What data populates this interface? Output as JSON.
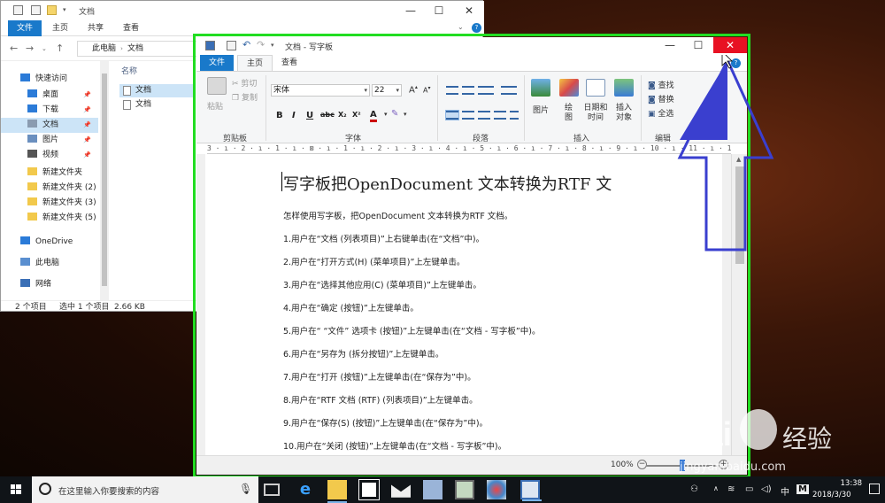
{
  "explorer": {
    "title": "文档",
    "window_controls": {
      "minimize": "—",
      "maximize": "☐",
      "close": "✕"
    },
    "tabs": [
      "文件",
      "主页",
      "共享",
      "查看"
    ],
    "breadcrumb": [
      "此电脑",
      "文档"
    ],
    "sidebar": {
      "items": [
        {
          "label": "快速访问",
          "icon": "star-icon"
        },
        {
          "label": "桌面",
          "icon": "desktop-icon",
          "pinned": true
        },
        {
          "label": "下载",
          "icon": "download-icon",
          "pinned": true
        },
        {
          "label": "文档",
          "icon": "document-icon",
          "pinned": true,
          "active": true
        },
        {
          "label": "图片",
          "icon": "picture-icon",
          "pinned": true
        },
        {
          "label": "视频",
          "icon": "video-icon",
          "pinned": true
        },
        {
          "label": "新建文件夹",
          "icon": "folder-icon"
        },
        {
          "label": "新建文件夹 (2)",
          "icon": "folder-icon"
        },
        {
          "label": "新建文件夹 (3)",
          "icon": "folder-icon"
        },
        {
          "label": "新建文件夹 (5)",
          "icon": "folder-icon"
        },
        {
          "label": "OneDrive",
          "icon": "cloud-icon"
        },
        {
          "label": "此电脑",
          "icon": "computer-icon"
        },
        {
          "label": "网络",
          "icon": "network-icon"
        }
      ]
    },
    "column_header": "名称",
    "files": [
      {
        "name": "文档",
        "selected": true
      },
      {
        "name": "文档",
        "selected": false
      }
    ],
    "status": {
      "count": "2 个项目",
      "selected": "选中 1 个项目",
      "size": "2.66 KB"
    }
  },
  "wordpad": {
    "title": "文档 - 写字板",
    "window_controls": {
      "minimize": "—",
      "maximize": "☐",
      "close": "✕"
    },
    "tabs": [
      "文件",
      "主页",
      "查看"
    ],
    "ribbon": {
      "clipboard": {
        "label": "剪贴板",
        "paste": "粘贴",
        "cut": "剪切",
        "copy": "复制"
      },
      "font": {
        "label": "字体",
        "font_name": "宋体",
        "font_size": "22",
        "bold": "B",
        "italic": "I",
        "underline": "U",
        "strike": "abc",
        "sub": "X₂",
        "sup": "X²",
        "color_a": "A"
      },
      "paragraph": {
        "label": "段落"
      },
      "insert": {
        "label": "插入",
        "picture": "图片",
        "paint": "绘图",
        "datetime": "日期和时间",
        "object": "插入对象"
      },
      "edit": {
        "label": "编辑",
        "find": "查找",
        "replace": "替换",
        "select_all": "全选"
      }
    },
    "ruler": "3 · ı · 2 · ı · 1 · ı · ⊠ · ı · 1 · ı · 2 · ı · 3 · ı · 4 · ı · 5 · ı · 6 · ı · 7 · ı · 8 · ı · 9 · ı · 10 · ı · 11 · ı · 12 · ı · 13 · ı · 14 · ı · 15 · ı · 16 · ı · 17 · ı",
    "document": {
      "title": "写字板把OpenDocument 文本转换为RTF 文",
      "lines": [
        "怎样使用写字板，把OpenDocument 文本转换为RTF 文档。",
        "1.用户在“文档 (列表项目)”上右键单击(在“文档”中)。",
        "2.用户在“打开方式(H) (菜单项目)”上左键单击。",
        "3.用户在“选择其他应用(C) (菜单项目)”上左键单击。",
        "4.用户在“确定 (按钮)”上左键单击。",
        "5.用户在“ “文件” 选项卡 (按钮)”上左键单击(在“文档 - 写字板”中)。",
        "6.用户在“另存为 (拆分按钮)”上左键单击。",
        "7.用户在“打开 (按钮)”上左键单击(在“保存为”中)。",
        "8.用户在“RTF 文档 (RTF) (列表项目)”上左键单击。",
        "9.用户在“保存(S) (按钮)”上左键单击(在“保存为”中)。",
        "10.用户在“关闭 (按钮)”上左键单击(在“文档 - 写字板”中)。"
      ]
    },
    "zoom": {
      "text": "100%",
      "minus": "−",
      "plus": "+",
      "level_percent": 100
    }
  },
  "taskbar": {
    "search_placeholder": "在这里输入你要搜索的内容",
    "tray": {
      "ime": "中",
      "ime_mode": "M",
      "time": "13:38",
      "date": "2018/3/30"
    }
  },
  "watermark": {
    "brand": "Bai",
    "brand_cn": "经验",
    "url": "jingyan.baidu.com"
  },
  "colors": {
    "accent": "#1979ca",
    "highlight_box": "#22dd22",
    "close_red": "#e81123",
    "arrow_blue": "#3a3fcf"
  }
}
